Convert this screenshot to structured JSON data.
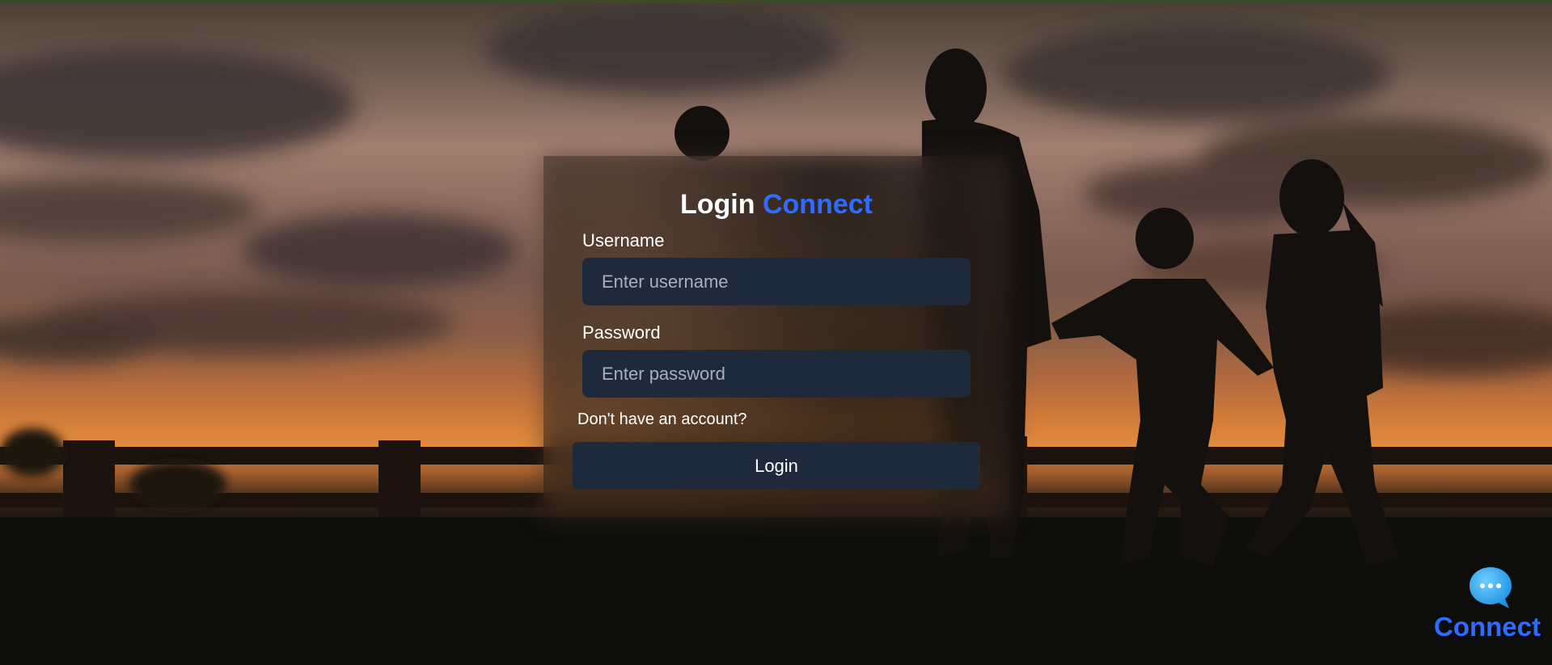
{
  "login": {
    "title_main": "Login",
    "title_accent": "Connect",
    "username_label": "Username",
    "username_placeholder": "Enter username",
    "username_value": "",
    "password_label": "Password",
    "password_placeholder": "Enter password",
    "password_value": "",
    "signup_prompt": "Don't have an account?",
    "submit_label": "Login"
  },
  "brand": {
    "name": "Connect",
    "icon": "chat-bubble-icon"
  },
  "colors": {
    "accent": "#2f6bff",
    "input_bg": "#1e293b",
    "button_bg": "#1e293b",
    "text": "#ffffff"
  }
}
